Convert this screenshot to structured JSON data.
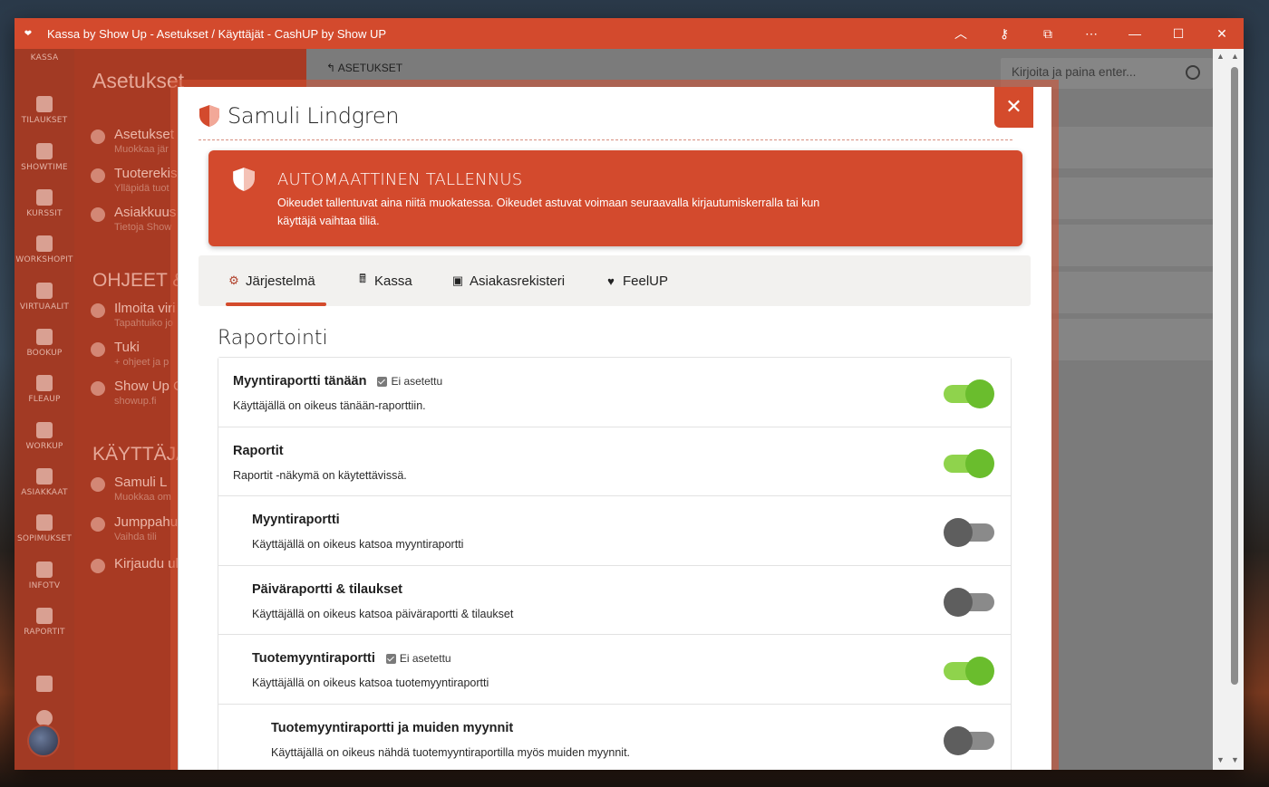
{
  "window": {
    "title": "Kassa by Show Up - Asetukset / Käyttäjät - CashUP by Show UP"
  },
  "titlebar_controls": [
    "chevron-up",
    "key",
    "cast",
    "more",
    "minimize",
    "maximize",
    "close"
  ],
  "titlebar_glyphs": {
    "chevron": "︿",
    "key": "⚷",
    "cast": "⧉",
    "more": "⋯",
    "minimize": "—",
    "maximize": "☐",
    "close": "✕"
  },
  "rail": {
    "items": [
      {
        "label": "KASSA"
      },
      {
        "label": "TILAUKSET"
      },
      {
        "label": "SHOWTIME"
      },
      {
        "label": "KURSSIT"
      },
      {
        "label": "WORKSHOPIT"
      },
      {
        "label": "VIRTUAALIT"
      },
      {
        "label": "BOOKUP"
      },
      {
        "label": "FLEAUP"
      },
      {
        "label": "WORKUP"
      },
      {
        "label": "ASIAKKAAT"
      },
      {
        "label": "SOPIMUKSET"
      },
      {
        "label": "INFOTV"
      },
      {
        "label": "RAPORTIT"
      }
    ]
  },
  "settings": {
    "title": "Asetukset",
    "items": [
      {
        "title": "Asetukset",
        "sub": "Muokkaa jär"
      },
      {
        "title": "Tuoterekis",
        "sub": "Ylläpidä tuot"
      },
      {
        "title": "Asiakkuus",
        "sub": "Tietoja Show"
      }
    ],
    "help_title": "OHJEET & T",
    "help_items": [
      {
        "title": "Ilmoita viri",
        "sub": "Tapahtuiko jo"
      },
      {
        "title": "Tuki",
        "sub": "+ ohjeet ja p"
      },
      {
        "title": "Show Up C",
        "sub": "showup.fi"
      }
    ],
    "user_title": "KÄYTTÄJÄ &",
    "user_items": [
      {
        "title": "Samuli L",
        "sub": "Muokkaa om"
      },
      {
        "title": "Jumppahu",
        "sub": "Vaihda tili"
      },
      {
        "title": "Kirjaudu ul",
        "sub": ""
      }
    ]
  },
  "main": {
    "breadcrumb": "ASETUKSET",
    "breadcrumb_icon": "↰",
    "search_placeholder": "Kirjoita ja paina enter..."
  },
  "modal": {
    "user_name": "Samuli Lindgren",
    "close_label": "✕",
    "notice": {
      "title": "AUTOMAATTINEN TALLENNUS",
      "text": "Oikeudet tallentuvat aina niitä muokatessa. Oikeudet astuvat voimaan seuraavalla kirjautumiskerralla tai kun käyttäjä vaihtaa tiliä."
    },
    "tabs": [
      {
        "label": "Järjestelmä",
        "icon": "⚙",
        "active": true
      },
      {
        "label": "Kassa",
        "icon": "🖩",
        "active": false
      },
      {
        "label": "Asiakasrekisteri",
        "icon": "▣",
        "active": false
      },
      {
        "label": "FeelUP",
        "icon": "♥",
        "active": false
      }
    ],
    "section_title": "Raportointi",
    "permissions": [
      {
        "title": "Myyntiraportti tänään",
        "badge": "Ei asetettu",
        "desc": "Käyttäjällä on oikeus tänään-raporttiin.",
        "enabled": true,
        "indent": 0
      },
      {
        "title": "Raportit",
        "badge": "",
        "desc": "Raportit -näkymä on käytettävissä.",
        "enabled": true,
        "indent": 0
      },
      {
        "title": "Myyntiraportti",
        "badge": "",
        "desc": "Käyttäjällä on oikeus katsoa myyntiraportti",
        "enabled": false,
        "indent": 1
      },
      {
        "title": "Päiväraportti & tilaukset",
        "badge": "",
        "desc": "Käyttäjällä on oikeus katsoa päiväraportti & tilaukset",
        "enabled": false,
        "indent": 1
      },
      {
        "title": "Tuotemyyntiraportti",
        "badge": "Ei asetettu",
        "desc": "Käyttäjällä on oikeus katsoa tuotemyyntiraportti",
        "enabled": true,
        "indent": 1
      },
      {
        "title": "Tuotemyyntiraportti ja muiden myynnit",
        "badge": "",
        "desc": "Käyttäjällä on oikeus nähdä tuotemyyntiraportilla myös muiden myynnit.",
        "enabled": false,
        "indent": 2
      }
    ]
  },
  "colors": {
    "accent": "#d34a2d",
    "toggle_on": "#6abd2d",
    "toggle_off": "#5e5e5e"
  }
}
